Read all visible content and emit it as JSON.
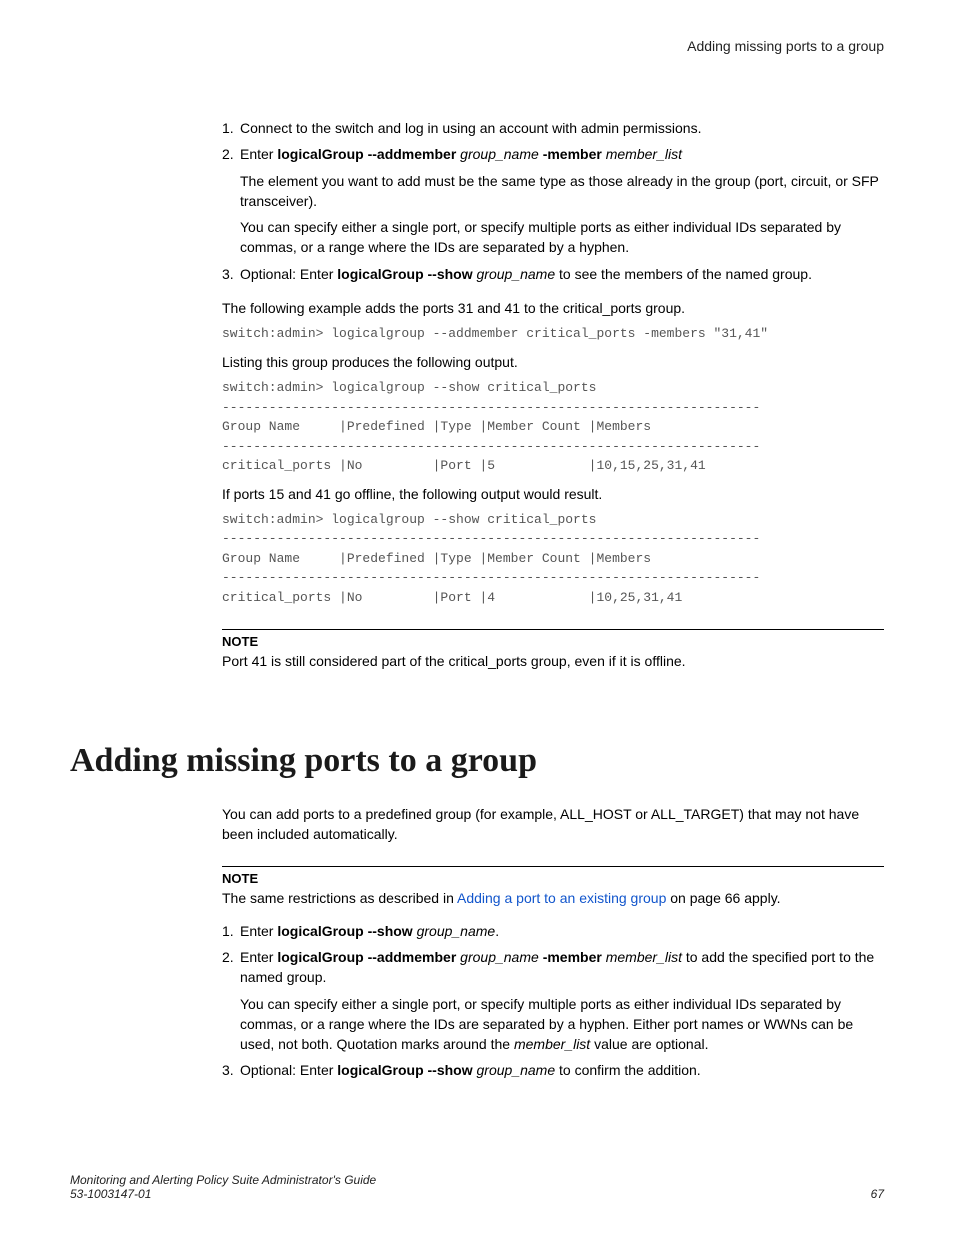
{
  "header": {
    "title": "Adding missing ports to a group"
  },
  "steps1": {
    "s1": "Connect to the switch and log in using an account with admin permissions.",
    "s2_prefix": "Enter ",
    "s2_cmd1": "logicalGroup --addmember",
    "s2_arg1": "group_name",
    "s2_cmd2": "-member",
    "s2_arg2": "member_list",
    "s2_sub1": "The element you want to add must be the same type as those already in the group (port, circuit, or SFP transceiver).",
    "s2_sub2": "You can specify either a single port, or specify multiple ports as either individual IDs separated by commas, or a range where the IDs are separated by a hyphen.",
    "s3_prefix": "Optional: Enter ",
    "s3_cmd": "logicalGroup --show",
    "s3_arg": "group_name",
    "s3_suffix": " to see the members of the named group."
  },
  "example": {
    "intro": "The following example adds the ports 31 and 41 to the critical_ports group.",
    "term1": "switch:admin> logicalgroup --addmember critical_ports -members \"31,41\"",
    "listing": "Listing this group produces the following output.",
    "term2": "switch:admin> logicalgroup --show critical_ports\n---------------------------------------------------------------------\nGroup Name     |Predefined |Type |Member Count |Members\n---------------------------------------------------------------------\ncritical_ports |No         |Port |5            |10,15,25,31,41",
    "offline": "If ports 15 and 41 go offline, the following output would result.",
    "term3": "switch:admin> logicalgroup --show critical_ports\n---------------------------------------------------------------------\nGroup Name     |Predefined |Type |Member Count |Members\n---------------------------------------------------------------------\ncritical_ports |No         |Port |4            |10,25,31,41"
  },
  "note1": {
    "label": "NOTE",
    "body": "Port 41 is still considered part of the critical_ports group, even if it is offline."
  },
  "section2": {
    "heading": "Adding missing ports to a group",
    "intro": "You can add ports to a predefined group (for example, ALL_HOST or ALL_TARGET) that may not have been included automatically."
  },
  "note2": {
    "label": "NOTE",
    "body_prefix": "The same restrictions as described in ",
    "link_text": "Adding a port to an existing group",
    "body_suffix": " on page 66 apply."
  },
  "steps2": {
    "s1_prefix": "Enter ",
    "s1_cmd": "logicalGroup --show",
    "s1_arg": "group_name",
    "s1_suffix": ".",
    "s2_prefix": "Enter ",
    "s2_cmd1": "logicalGroup --addmember",
    "s2_arg1": "group_name",
    "s2_cmd2": "-member",
    "s2_arg2": "member_list",
    "s2_suffix": " to add the specified port to the named group.",
    "s2_sub_a": "You can specify either a single port, or specify multiple ports as either individual IDs separated by commas, or a range where the IDs are separated by a hyphen. Either port names or WWNs can be used, not both. Quotation marks around the ",
    "s2_sub_ital": "member_list",
    "s2_sub_b": " value are optional.",
    "s3_prefix": "Optional: Enter ",
    "s3_cmd": "logicalGroup --show",
    "s3_arg": "group_name",
    "s3_suffix": " to confirm the addition."
  },
  "footer": {
    "left1": "Monitoring and Alerting Policy Suite Administrator's Guide",
    "left2": "53-1003147-01",
    "right": "67"
  }
}
